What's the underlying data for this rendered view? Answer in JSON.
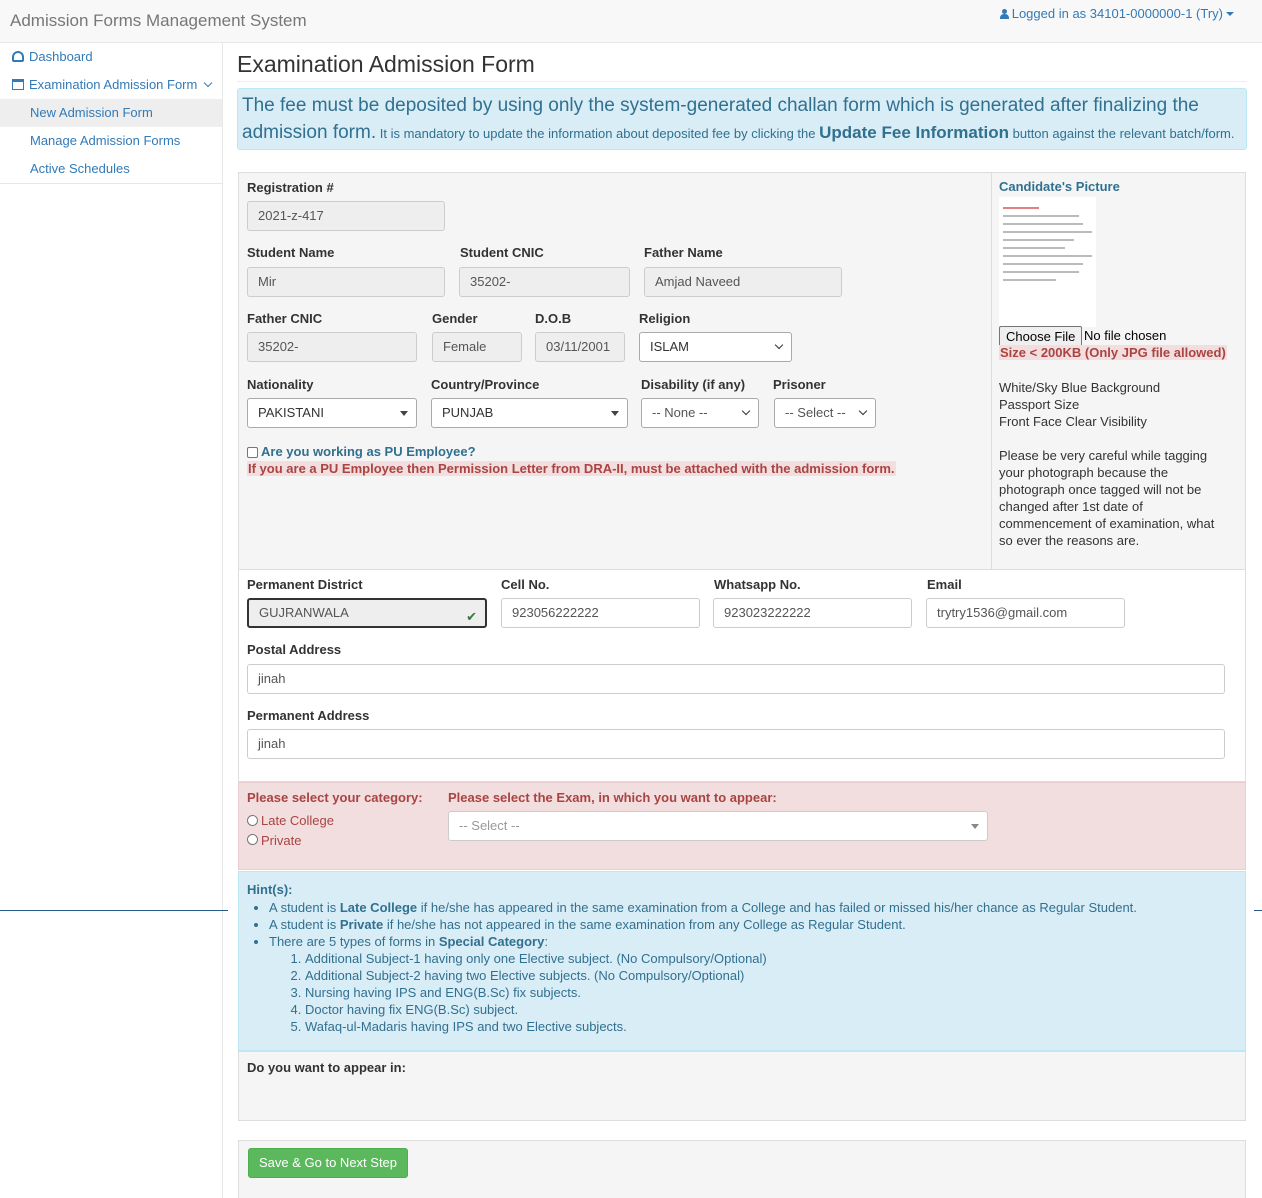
{
  "app": {
    "title": "Admission Forms Management System",
    "user": "Logged in as 34101-0000000-1 (Try)"
  },
  "sidebar": {
    "items": [
      {
        "label": "Dashboard"
      },
      {
        "label": "Examination Admission Form"
      },
      {
        "label": "New Admission Form"
      },
      {
        "label": "Manage Admission Forms"
      },
      {
        "label": "Active Schedules"
      }
    ]
  },
  "page": {
    "title": "Examination Admission Form"
  },
  "notice": {
    "big": "The fee must be deposited by using only the system-generated challan form which is generated after finalizing the admission form.",
    "small1": "It is mandatory to update the information about deposited fee by clicking the",
    "bold": "Update Fee Information",
    "small2": "button against the relevant batch/form."
  },
  "form": {
    "registration": {
      "label": "Registration #",
      "value": "2021-z-417"
    },
    "student_name": {
      "label": "Student Name",
      "value": "Mir"
    },
    "student_cnic": {
      "label": "Student CNIC",
      "value": "35202-"
    },
    "father_name": {
      "label": "Father Name",
      "value": "Amjad Naveed"
    },
    "father_cnic": {
      "label": "Father CNIC",
      "value": "35202-"
    },
    "gender": {
      "label": "Gender",
      "value": "Female"
    },
    "dob": {
      "label": "D.O.B",
      "value": "03/11/2001"
    },
    "religion": {
      "label": "Religion",
      "value": "ISLAM"
    },
    "nationality": {
      "label": "Nationality",
      "value": "PAKISTANI"
    },
    "country": {
      "label": "Country/Province",
      "value": "PUNJAB"
    },
    "disability": {
      "label": "Disability (if any)",
      "value": "-- None --"
    },
    "prisoner": {
      "label": "Prisoner",
      "value": "-- Select --"
    },
    "pu_employee": {
      "label": "Are you working as PU Employee?",
      "warning": "If you are a PU Employee then Permission Letter from DRA-II, must be attached with the admission form."
    },
    "district": {
      "label": "Permanent District",
      "value": "GUJRANWALA"
    },
    "cell": {
      "label": "Cell No.",
      "value": "923056222222"
    },
    "whatsapp": {
      "label": "Whatsapp No.",
      "value": "923023222222"
    },
    "email": {
      "label": "Email",
      "value": "trytry1536@gmail.com"
    },
    "postal": {
      "label": "Postal Address",
      "value": "jinah"
    },
    "permanent": {
      "label": "Permanent Address",
      "value": "jinah"
    }
  },
  "picture": {
    "title": "Candidate's Picture",
    "choose": "Choose File",
    "nofile": "No file chosen",
    "size": "Size < 200KB (Only JPG file allowed)",
    "req1": "White/Sky Blue Background",
    "req2": "Passport Size",
    "req3": "Front Face Clear Visibility",
    "note": "Please be very careful while tagging your photograph because the photograph once tagged will not be changed after 1st date of commencement of examination, what so ever the reasons are."
  },
  "category": {
    "label": "Please select your category:",
    "options": [
      "Late College",
      "Private"
    ],
    "exam_label": "Please select the Exam, in which you want to appear:",
    "exam_value": "-- Select --"
  },
  "hints": {
    "title": "Hint(s):",
    "h1a": "A student is",
    "h1b": "Late College",
    "h1c": "if he/she has appeared in the same examination from a College and has failed or missed his/her chance as Regular Student.",
    "h2a": "A student is",
    "h2b": "Private",
    "h2c": "if he/she has not appeared in the same examination from any College as Regular Student.",
    "h3a": "There are 5 types of forms in",
    "h3b": "Special Category",
    "h3c": ":",
    "types": [
      "Additional Subject-1 having only one Elective subject. (No Compulsory/Optional)",
      "Additional Subject-2 having two Elective subjects. (No Compulsory/Optional)",
      "Nursing having IPS and ENG(B.Sc) fix subjects.",
      "Doctor having fix ENG(B.Sc) subject.",
      "Wafaq-ul-Madaris having IPS and two Elective subjects."
    ]
  },
  "appear": {
    "label": "Do you want to appear in:"
  },
  "actions": {
    "save": "Save & Go to Next Step"
  },
  "colors": {
    "accent": "#337ab7",
    "info_bg": "#d9edf7",
    "danger_bg": "#f2dede",
    "success": "#5cb85c"
  }
}
